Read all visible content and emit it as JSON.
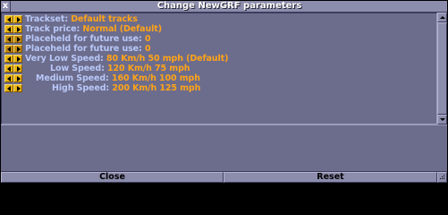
{
  "window": {
    "title": "Change NewGRF parameters",
    "close_glyph": "x"
  },
  "parameters": [
    {
      "label": "Trackset: ",
      "value": "Default tracks",
      "left_enabled": true,
      "right_enabled": true
    },
    {
      "label": "Track price: ",
      "value": "Normal (Default)",
      "left_enabled": true,
      "right_enabled": true
    },
    {
      "label": "Placeheld for future use: ",
      "value": "0",
      "left_enabled": false,
      "right_enabled": false
    },
    {
      "label": "Placeheld for future use: ",
      "value": "0",
      "left_enabled": false,
      "right_enabled": false
    },
    {
      "label": "Very Low Speed: ",
      "value": "80 Km/h 50 mph (Default)",
      "left_enabled": true,
      "right_enabled": true
    },
    {
      "label": "Low Speed: ",
      "value": "120 Km/h 75 mph",
      "left_enabled": true,
      "right_enabled": true
    },
    {
      "label": "Medium Speed: ",
      "value": "160 Km/h 100 mph",
      "left_enabled": true,
      "right_enabled": true
    },
    {
      "label": "High Speed: ",
      "value": "200 Km/h 125 mph",
      "left_enabled": true,
      "right_enabled": true
    }
  ],
  "buttons": {
    "close_label": "Close",
    "reset_label": "Reset"
  },
  "colors": {
    "window_bg": "#6c6c8c",
    "label_text": "#b8c8f8",
    "value_text": "#ffa418",
    "arrow_button": "#e8b410"
  },
  "icons": {
    "decrease": "left-arrow-icon",
    "increase": "right-arrow-icon",
    "scroll_up": "up-arrow-icon",
    "scroll_down": "down-arrow-icon"
  }
}
